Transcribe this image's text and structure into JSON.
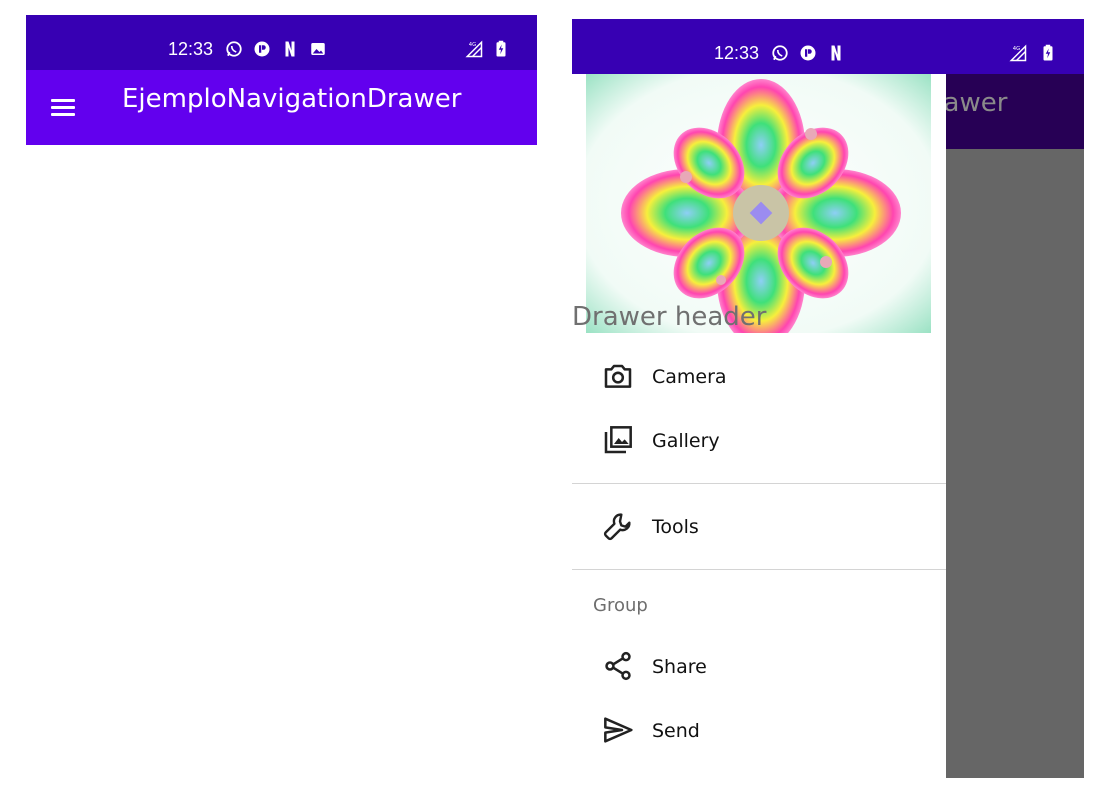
{
  "left_screen": {
    "status_bar": {
      "time": "12:33",
      "icons": [
        "whatsapp-icon",
        "app-notification-icon",
        "netflix-icon",
        "image-icon",
        "signal-4g-icon",
        "battery-charging-icon"
      ]
    },
    "app_bar": {
      "title": "EjemploNavigationDrawer",
      "menu_icon": "hamburger-menu-icon"
    }
  },
  "right_screen": {
    "status_bar": {
      "time": "12:33",
      "icons": [
        "whatsapp-icon",
        "app-notification-icon",
        "netflix-icon",
        "signal-4g-icon",
        "battery-charging-icon"
      ]
    },
    "app_bar": {
      "title": "EjemploNavigationDrawer"
    },
    "drawer": {
      "header_title": "Drawer header",
      "header_image": "fractal-flower-image",
      "items": [
        {
          "label": "Camera",
          "icon": "camera-icon"
        },
        {
          "label": "Gallery",
          "icon": "gallery-icon"
        },
        {
          "label": "Tools",
          "icon": "wrench-icon"
        }
      ],
      "group_label": "Group",
      "group_items": [
        {
          "label": "Share",
          "icon": "share-icon"
        },
        {
          "label": "Send",
          "icon": "send-icon"
        }
      ]
    }
  },
  "colors": {
    "status_bar": "#3700b3",
    "app_bar": "#6200ee",
    "app_bar_dimmed": "#270055",
    "scrim": "#666666"
  }
}
